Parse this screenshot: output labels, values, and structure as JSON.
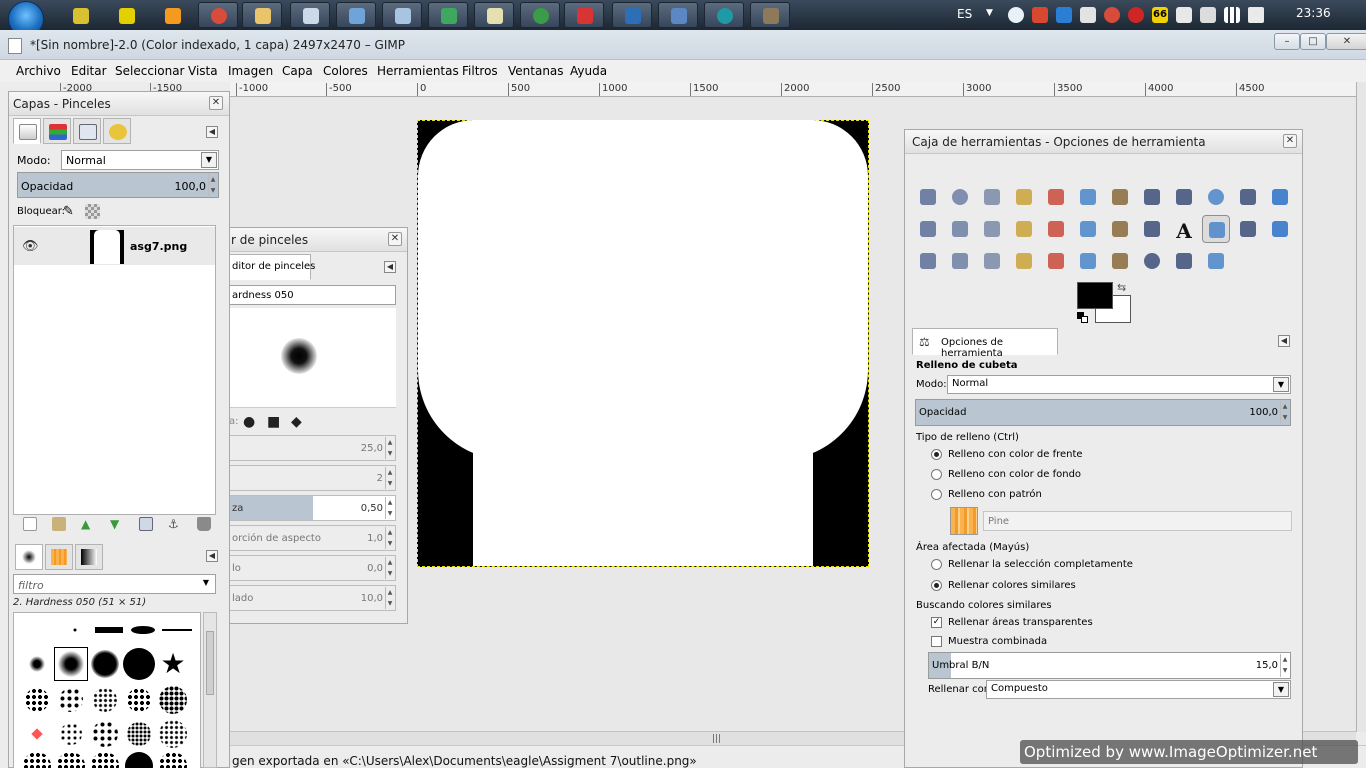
{
  "taskbar": {
    "lang": "ES",
    "clock": "23:36",
    "tray_badge": "66"
  },
  "window": {
    "title": "*[Sin nombre]-2.0 (Color indexado, 1 capa) 2497x2470 – GIMP",
    "minimize": "–",
    "maximize": "□",
    "close": "✕"
  },
  "menu": [
    "Archivo",
    "Editar",
    "Seleccionar",
    "Vista",
    "Imagen",
    "Capa",
    "Colores",
    "Herramientas",
    "Filtros",
    "Ventanas",
    "Ayuda"
  ],
  "ruler_h": [
    "-2000",
    "-1500",
    "-1000",
    "-500",
    "0",
    "500",
    "1000",
    "1500",
    "2000",
    "2500",
    "3000",
    "3500",
    "4000",
    "4500"
  ],
  "status": {
    "text": "gen exportada en «C:\\Users\\Alex\\Documents\\eagle\\Assigment 7\\outline.png»"
  },
  "layers_panel": {
    "title": "Capas - Pinceles",
    "mode_label": "Modo:",
    "mode_value": "Normal",
    "opacity_label": "Opacidad",
    "opacity_value": "100,0",
    "opacity_fraction": 1.0,
    "lock_label": "Bloquear:",
    "layer_name": "asg7.png",
    "brush_filter_placeholder": "filtro",
    "brush_name": "2. Hardness 050 (51 × 51)"
  },
  "brush_editor": {
    "title": "r de pinceles",
    "tab": "ditor de pinceles",
    "name": "ardness 050",
    "shape_label": "a:",
    "rows": [
      {
        "label": "",
        "value": "25,0",
        "fill": 0.0
      },
      {
        "label": "",
        "value": "2",
        "fill": 0.0
      },
      {
        "label": "za",
        "value": "0,50",
        "fill": 0.5
      },
      {
        "label": "orción de aspecto",
        "value": "1,0",
        "fill": 0.0
      },
      {
        "label": "lo",
        "value": "0,0",
        "fill": 0.0
      },
      {
        "label": "lado",
        "value": "10,0",
        "fill": 0.0
      }
    ]
  },
  "toolbox": {
    "title": "Caja de herramientas - Opciones de herramienta",
    "tools": [
      "rect-select",
      "ellipse-select",
      "free-select",
      "fuzzy-select",
      "select-by-color",
      "scissors-select",
      "foreground-select",
      "paths",
      "color-picker",
      "zoom",
      "measure",
      "move",
      "align",
      "crop",
      "rotate",
      "scale",
      "shear",
      "perspective",
      "flip",
      "cage-transform",
      "text",
      "bucket-fill",
      "blend",
      "pencil",
      "paintbrush",
      "eraser",
      "airbrush",
      "ink",
      "clone",
      "heal",
      "perspective-clone",
      "blur",
      "smudge",
      "dodge-burn"
    ],
    "text_tool_glyph": "A",
    "swap_glyph": "⇆"
  },
  "tool_options": {
    "tab": "Opciones de herramienta",
    "heading": "Relleno de cubeta",
    "mode_label": "Modo:",
    "mode_value": "Normal",
    "opacity_label": "Opacidad",
    "opacity_value": "100,0",
    "opacity_fraction": 1.0,
    "fill_type_label": "Tipo de relleno  (Ctrl)",
    "fill_fg": "Relleno con color de frente",
    "fill_bg": "Relleno con color de fondo",
    "fill_pattern": "Relleno con patrón",
    "pattern_name": "Pine",
    "area_label": "Área afectada  (Mayús)",
    "area_selection": "Rellenar la selección completamente",
    "area_similar": "Rellenar colores similares",
    "similar_label": "Buscando colores similares",
    "transparent_areas": "Rellenar áreas transparentes",
    "sample_merged": "Muestra combinada",
    "threshold_label": "Umbral B/N",
    "threshold_value": "15,0",
    "threshold_fraction": 0.06,
    "fill_with_label": "Rellenar con:",
    "fill_with_value": "Compuesto"
  },
  "watermark": "Optimized by  www.ImageOptimizer.net"
}
